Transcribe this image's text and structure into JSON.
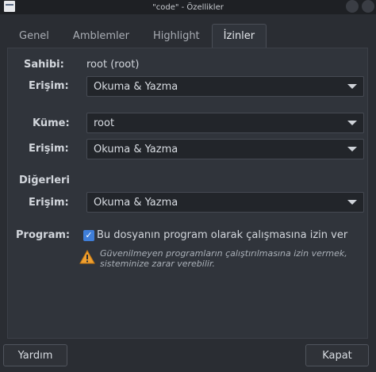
{
  "window": {
    "title": "\"code\" - Özellikler"
  },
  "tabs": [
    {
      "label": "Genel"
    },
    {
      "label": "Amblemler"
    },
    {
      "label": "Highlight"
    },
    {
      "label": "İzinler"
    }
  ],
  "permissions": {
    "owner_label": "Sahibi:",
    "owner_value": "root (root)",
    "owner_access_label": "Erişim:",
    "owner_access_value": "Okuma & Yazma",
    "group_label": "Küme:",
    "group_value": "root",
    "group_access_label": "Erişim:",
    "group_access_value": "Okuma & Yazma",
    "others_heading": "Diğerleri",
    "others_access_label": "Erişim:",
    "others_access_value": "Okuma & Yazma",
    "program_label": "Program:",
    "program_checkbox_label": "Bu dosyanın program olarak çalışmasına izin ver",
    "program_checked": true,
    "warning_text": "Güvenilmeyen programların çalıştırılmasına izin vermek, sisteminize zarar verebilir."
  },
  "footer": {
    "help_label": "Yardım",
    "close_label": "Kapat"
  },
  "colors": {
    "accent": "#3f7ed8",
    "warning": "#f0a030"
  }
}
